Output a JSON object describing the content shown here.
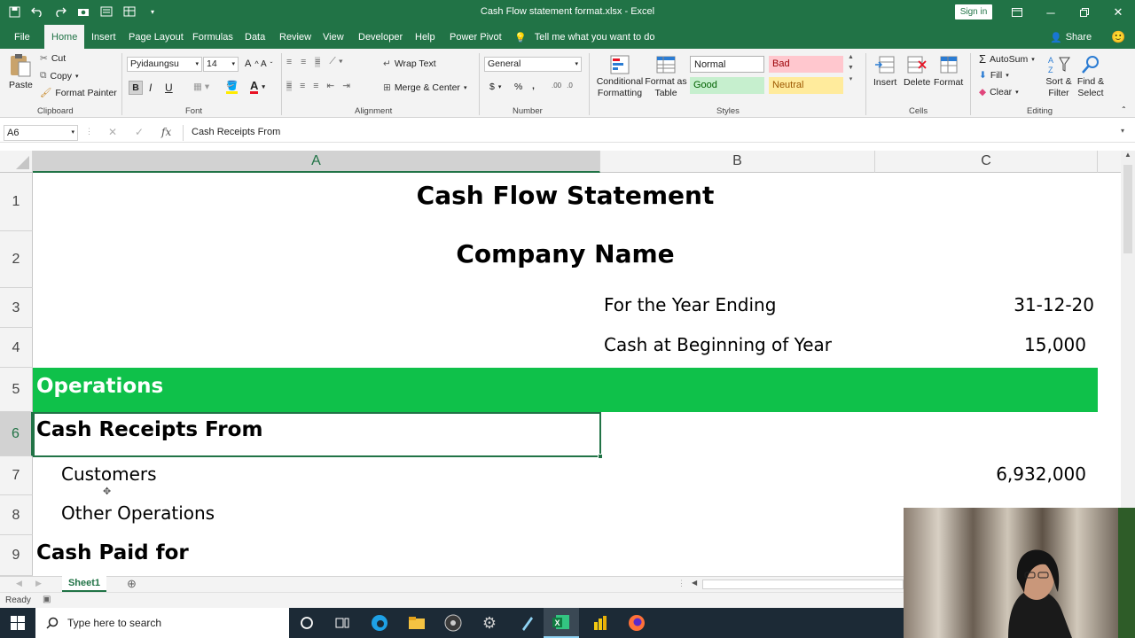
{
  "window": {
    "title": "Cash Flow statement format.xlsx  -  Excel",
    "signin": "Sign in"
  },
  "tabs": [
    "File",
    "Home",
    "Insert",
    "Page Layout",
    "Formulas",
    "Data",
    "Review",
    "View",
    "Developer",
    "Help",
    "Power Pivot"
  ],
  "tell_me": "Tell me what you want to do",
  "share": "Share",
  "clipboard": {
    "paste": "Paste",
    "cut": "Cut",
    "copy": "Copy",
    "format_painter": "Format Painter",
    "label": "Clipboard"
  },
  "font": {
    "name": "Pyidaungsu",
    "size": "14",
    "bold": "B",
    "italic": "I",
    "underline": "U",
    "label": "Font"
  },
  "alignment": {
    "wrap": "Wrap Text",
    "merge": "Merge & Center",
    "label": "Alignment"
  },
  "number": {
    "format": "General",
    "currency": "$",
    "percent": "%",
    "comma": ",",
    "label": "Number"
  },
  "styles": {
    "conditional": "Conditional Formatting",
    "format_as_table": "Format as Table",
    "normal": "Normal",
    "bad": "Bad",
    "good": "Good",
    "neutral": "Neutral",
    "label": "Styles"
  },
  "cells_group": {
    "insert": "Insert",
    "delete": "Delete",
    "format": "Format",
    "label": "Cells"
  },
  "editing": {
    "autosum": "AutoSum",
    "fill": "Fill",
    "clear": "Clear",
    "sort": "Sort & Filter",
    "find": "Find & Select",
    "label": "Editing"
  },
  "formula_bar": {
    "name_box": "A6",
    "fx": "fx",
    "content": "Cash Receipts From"
  },
  "columns": [
    "A",
    "B",
    "C"
  ],
  "rows": [
    "1",
    "2",
    "3",
    "4",
    "5",
    "6",
    "7",
    "8",
    "9"
  ],
  "sheet": {
    "title": "Cash Flow Statement",
    "company": "Company Name",
    "year_label": "For the Year Ending",
    "year_value": "31-12-20",
    "beginning_label": "Cash at Beginning of Year",
    "beginning_value": "15,000",
    "operations": "Operations",
    "receipts": "Cash Receipts From",
    "customers": "Customers",
    "customers_value": "6,932,000",
    "other": "Other Operations",
    "paid": "Cash Paid for"
  },
  "sheet_tab": "Sheet1",
  "status": "Ready",
  "taskbar": {
    "search_placeholder": "Type here to search"
  },
  "colors": {
    "excel_green": "#217346",
    "operations_fill": "#0fc14a",
    "bad_fill": "#ffc7ce",
    "good_fill": "#c6efce",
    "neutral_fill": "#ffeb9c"
  }
}
